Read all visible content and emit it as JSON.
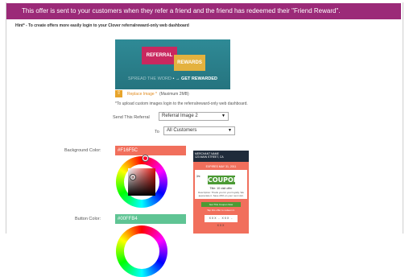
{
  "banner": {
    "text": "This offer is sent to your customers when they refer a friend and the friend has redeemed their \"Friend Reward\"."
  },
  "hint": "Hint* - To create offers more easily login to your Clover referralreward-only web dashboard",
  "promo_image": {
    "bubble_left": "REFERRAL",
    "bubble_right": "REWARDS",
    "tagline_light": "SPREAD THE WORD",
    "tagline_arrow": "• →",
    "tagline_bold": "GET REWARDED"
  },
  "replace_image": {
    "label": "Replace Image *",
    "max": "(Maximum 2MB)",
    "icon": "upload-icon"
  },
  "upload_note": "*To upload custom images login to the referralreward-only web dashboard.",
  "send_referral": {
    "label": "Send This Referral",
    "value": "Referral Image 2"
  },
  "to": {
    "label": "To",
    "value": "All Customers"
  },
  "background_color": {
    "label": "Background Color:",
    "value": "#F16F5C",
    "color": "#F16F5C"
  },
  "button_color": {
    "label": "Button Color:",
    "value": "#00FFB4",
    "color": "#5FC494"
  },
  "coupon_preview": {
    "merchant_name": "MERCHANT NAME",
    "merchant_address": "123 MAIN STREET, CA",
    "expires": "EXPIRES MAY 31, 2011",
    "badge": "COUPONS",
    "title": "Title: 10 visit offer",
    "description": "Description: Thank you for your loyalty. We appreciate it. Save 20% on your next visit.",
    "button": "Get This Coupon Now",
    "note": "Tap this offer to redeem it.",
    "code": "XXX - XXX - XXX"
  }
}
